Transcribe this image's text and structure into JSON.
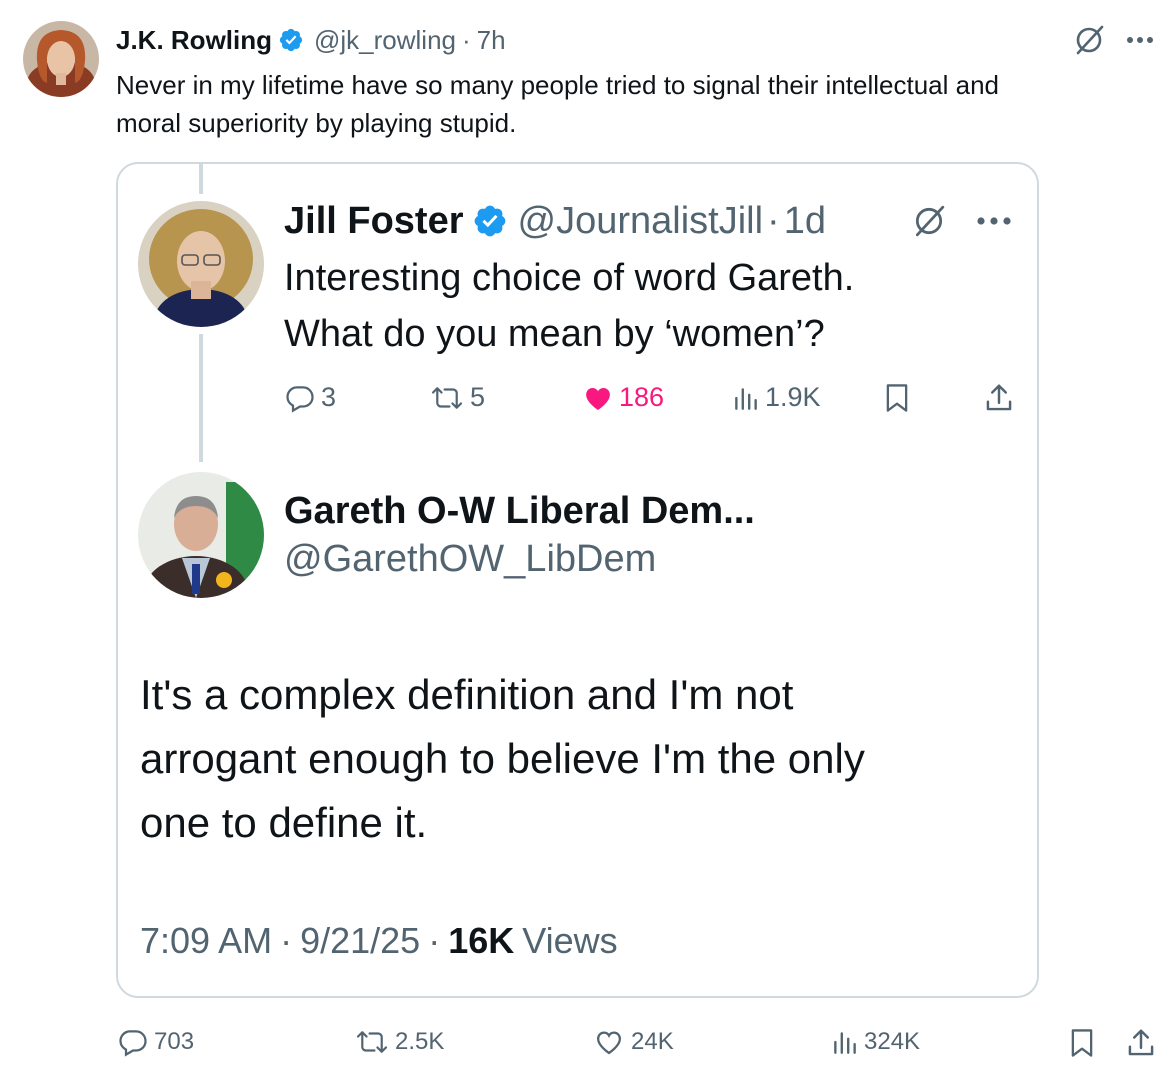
{
  "main_post": {
    "author_name": "J.K. Rowling",
    "handle": "@jk_rowling",
    "separator": "·",
    "time": "7h",
    "text_line1": "Never in my lifetime have so many people tried to signal their intellectual and",
    "text_line2": "moral superiority by playing stupid.",
    "stats": {
      "replies": "703",
      "reposts": "2.5K",
      "likes": "24K",
      "views": "324K"
    }
  },
  "quoted_reply": {
    "author_name": "Jill Foster",
    "handle": "@JournalistJill",
    "separator": "·",
    "time": "1d",
    "text_line1": "Interesting choice of word Gareth.",
    "text_line2": "What do you mean by ‘women’?",
    "stats": {
      "replies": "3",
      "reposts": "5",
      "likes": "186",
      "views": "1.9K"
    }
  },
  "quoted_original": {
    "author_name": "Gareth O-W Liberal Dem...",
    "handle": "@GarethOW_LibDem",
    "text_line1": "It's a complex definition and I'm not",
    "text_line2": "arrogant enough to believe I'm the only",
    "text_line3": "one to define it.",
    "time": "7:09 AM",
    "separator": "·",
    "date": "9/21/25",
    "views_count": "16K",
    "views_label": "Views"
  },
  "colors": {
    "verified": "#1d9bf0",
    "like_pink": "#f91880",
    "muted_text": "#536471",
    "border": "#cfd9de"
  },
  "icons": [
    "verified-badge-icon",
    "grok-icon",
    "more-icon",
    "reply-icon",
    "repost-icon",
    "like-icon",
    "views-icon",
    "bookmark-icon",
    "share-icon"
  ]
}
